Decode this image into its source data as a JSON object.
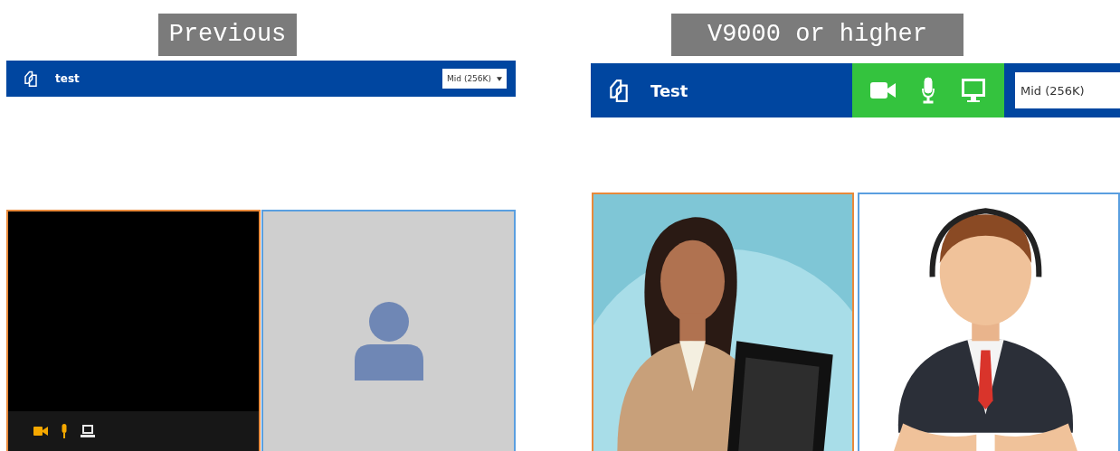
{
  "panels": [
    {
      "caption": "Previous",
      "kind": "compact",
      "title": "test",
      "quality": "Mid (256K)",
      "caret": true,
      "tiles": [
        {
          "kind": "video",
          "active": true,
          "controls": [
            {
              "kind": "camera",
              "on": true
            },
            {
              "kind": "mic",
              "on": true
            },
            {
              "kind": "screen",
              "on": false
            }
          ]
        },
        {
          "kind": "avatar",
          "active": false
        }
      ]
    },
    {
      "caption": "V9000 or higher",
      "kind": "wide",
      "title": "Test",
      "quality": "Mid (256K)",
      "caret": false,
      "header_controls": [
        {
          "kind": "camera",
          "on": true
        },
        {
          "kind": "mic",
          "on": true
        },
        {
          "kind": "screen",
          "on": true
        }
      ],
      "tiles": [
        {
          "kind": "picture",
          "active": true
        },
        {
          "kind": "picture",
          "active": false
        }
      ]
    }
  ]
}
